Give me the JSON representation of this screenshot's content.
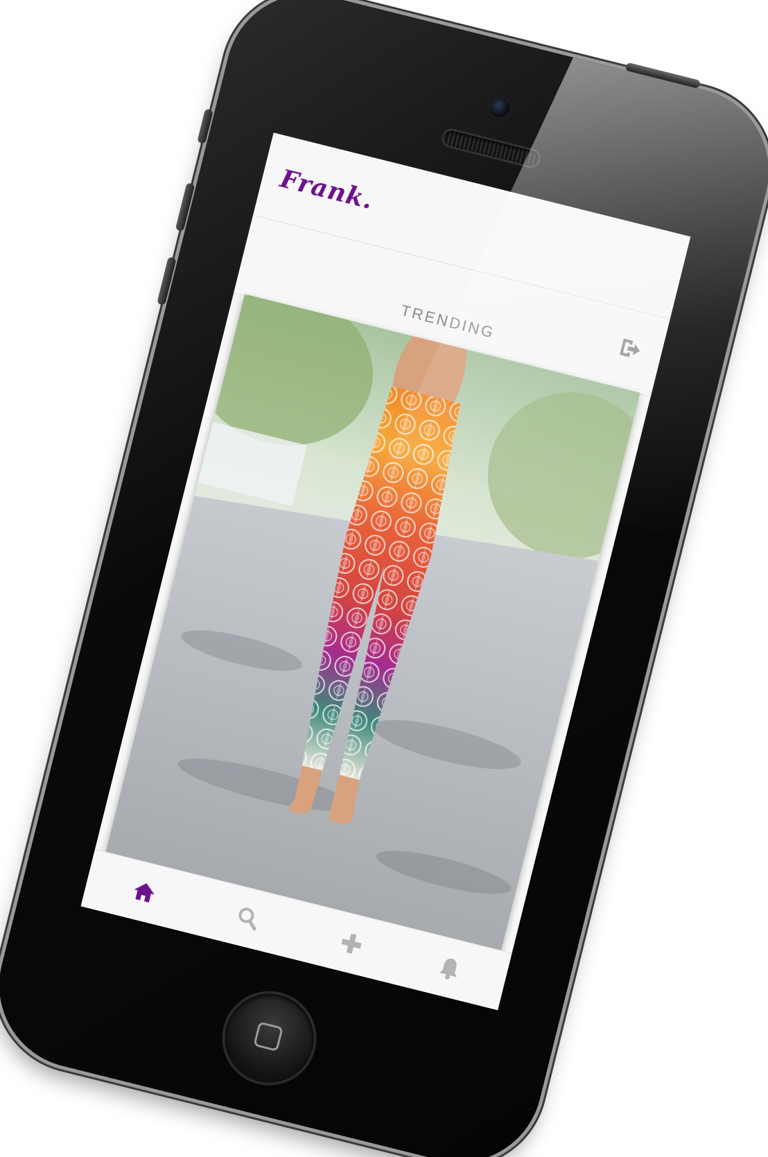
{
  "app": {
    "logo": "Frank.",
    "brand_color": "#6d128f"
  },
  "header": {
    "section_title": "TRENDING",
    "logout_icon": "logout-icon"
  },
  "feed": {
    "photo_icon": "leggings-photo"
  },
  "tabbar": {
    "active_color": "#6d128f",
    "inactive_color": "#b3b3b3",
    "tabs": [
      {
        "icon": "home-icon",
        "active": true
      },
      {
        "icon": "search-icon",
        "active": false
      },
      {
        "icon": "plus-icon",
        "active": false
      },
      {
        "icon": "bell-icon",
        "active": false
      }
    ]
  }
}
